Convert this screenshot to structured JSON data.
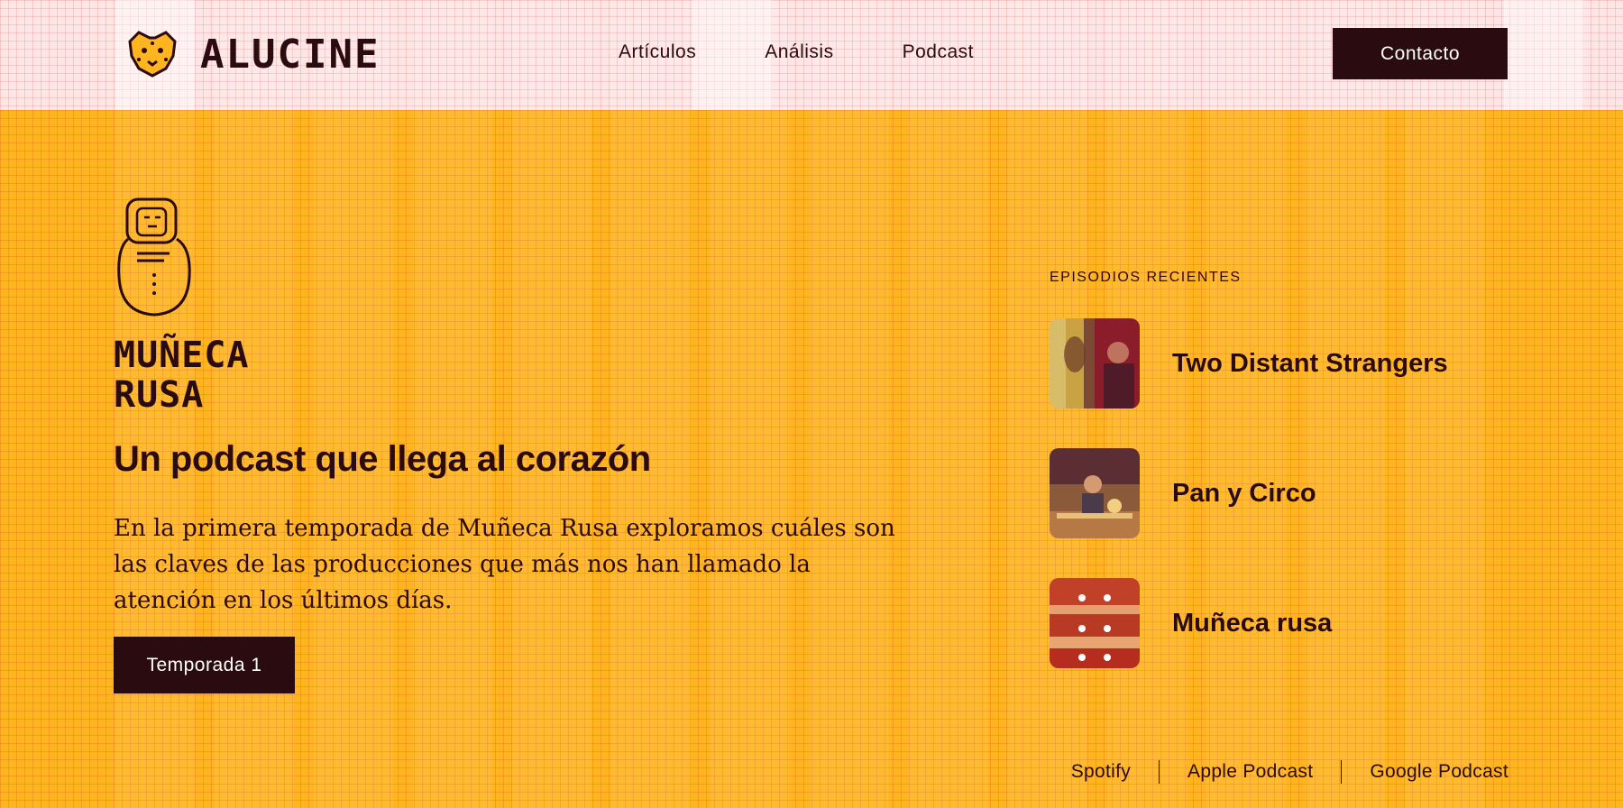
{
  "header": {
    "logo_text": "ALUCINE",
    "nav": [
      "Artículos",
      "Análisis",
      "Podcast"
    ],
    "contact_label": "Contacto"
  },
  "hero": {
    "show_title_art": "MUÑECA RUSA",
    "headline": "Un podcast que llega al corazón",
    "description": "En la primera temporada de Muñeca Rusa exploramos cuáles son las claves de las producciones que más nos han llamado la atención en los últimos días.",
    "season_button": "Temporada 1"
  },
  "recent": {
    "heading": "EPISODIOS RECIENTES",
    "episodes": [
      {
        "title": "Two Distant Strangers"
      },
      {
        "title": "Pan y Circo"
      },
      {
        "title": "Muñeca rusa"
      }
    ]
  },
  "footer": {
    "links": [
      "Spotify",
      "Apple Podcast",
      "Google Podcast"
    ]
  },
  "colors": {
    "accent": "#ffb51f",
    "dark": "#2a0b10",
    "header_bg": "#ffe6e6"
  }
}
